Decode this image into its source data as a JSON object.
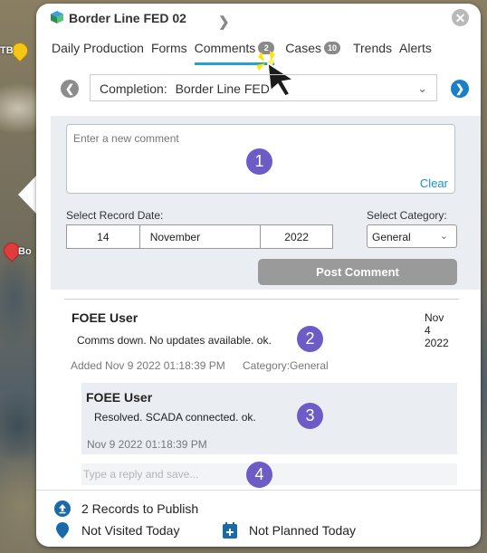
{
  "map": {
    "pin_label_1": "TB",
    "pin_label_2": "Bo"
  },
  "header": {
    "title": "Border Line FED 02"
  },
  "tabs": [
    {
      "label": "Daily Production"
    },
    {
      "label": "Forms"
    },
    {
      "label": "Comments",
      "badge": "2",
      "active": true
    },
    {
      "label": "Cases",
      "badge": "10"
    },
    {
      "label": "Trends"
    },
    {
      "label": "Alerts"
    }
  ],
  "selector": {
    "label": "Completion:",
    "value": "Border Line FED"
  },
  "form": {
    "comment_placeholder": "Enter a new comment",
    "clear_label": "Clear",
    "record_date_label": "Select Record Date:",
    "day": "14",
    "month": "November",
    "year": "2022",
    "category_label": "Select Category:",
    "category_value": "General",
    "post_label": "Post Comment"
  },
  "comments": [
    {
      "user": "FOEE User",
      "date": "Nov 4 2022",
      "text": "Comms down. No updates available. ok.",
      "added": "Added Nov 9 2022 01:18:39 PM",
      "category": "Category:General",
      "replies": [
        {
          "user": "FOEE User",
          "text": "Resolved. SCADA connected. ok.",
          "date": "Nov 9 2022 01:18:39 PM"
        }
      ],
      "reply_placeholder": "Type a reply and save..."
    }
  ],
  "steps": [
    "1",
    "2",
    "3",
    "4"
  ],
  "footer": {
    "publish": "2 Records to Publish",
    "visited": "Not Visited Today",
    "planned": "Not Planned Today"
  },
  "colors": {
    "accent": "#1da1d6",
    "step_badge": "#6d5bc6",
    "nav_right": "#1a7fc7"
  }
}
